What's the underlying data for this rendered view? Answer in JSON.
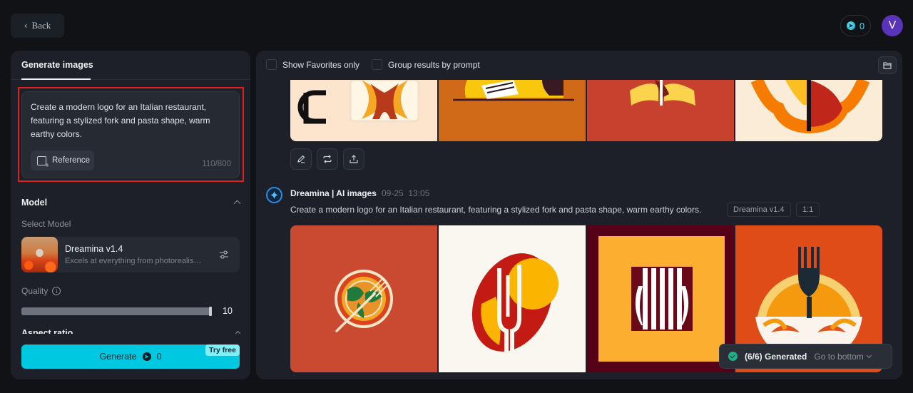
{
  "topbar": {
    "back_label": "Back",
    "credits": "0",
    "avatar_initial": "V"
  },
  "left_panel": {
    "tab_label": "Generate images",
    "prompt": {
      "text": "Create a modern logo for an Italian restaurant, featuring a stylized fork and pasta shape, warm earthy colors.",
      "char_count": "110/800",
      "reference_label": "Reference"
    },
    "model_section": {
      "title": "Model",
      "select_label": "Select Model",
      "model_name": "Dreamina v1.4",
      "model_desc": "Excels at everything from photorealism to painterly styles"
    },
    "quality": {
      "label": "Quality",
      "value": "10",
      "fraction": 1.0
    },
    "aspect_ratio_title": "Aspect ratio",
    "generate": {
      "label": "Generate",
      "cost": "0",
      "badge": "Try free"
    }
  },
  "right_panel": {
    "filters": [
      {
        "label": "Show Favorites only",
        "checked": false
      },
      {
        "label": "Group results by prompt",
        "checked": false
      }
    ],
    "actions": [
      "edit",
      "regenerate",
      "export"
    ],
    "result": {
      "author": "Dreamina | AI images",
      "date": "09-25",
      "time": "13:05",
      "prompt": "Create a modern logo for an Italian restaurant, featuring a stylized fork and pasta shape, warm earthy colors.",
      "model_tag": "Dreamina v1.4",
      "ratio_tag": "1:1"
    },
    "toast": {
      "status": "(6/6) Generated",
      "link": "Go to bottom"
    }
  },
  "colors": {
    "accent": "#00c8e0",
    "highlight_outline": "#e02020",
    "avatar_bg": "#5a34b8",
    "success": "#1fb08a"
  }
}
